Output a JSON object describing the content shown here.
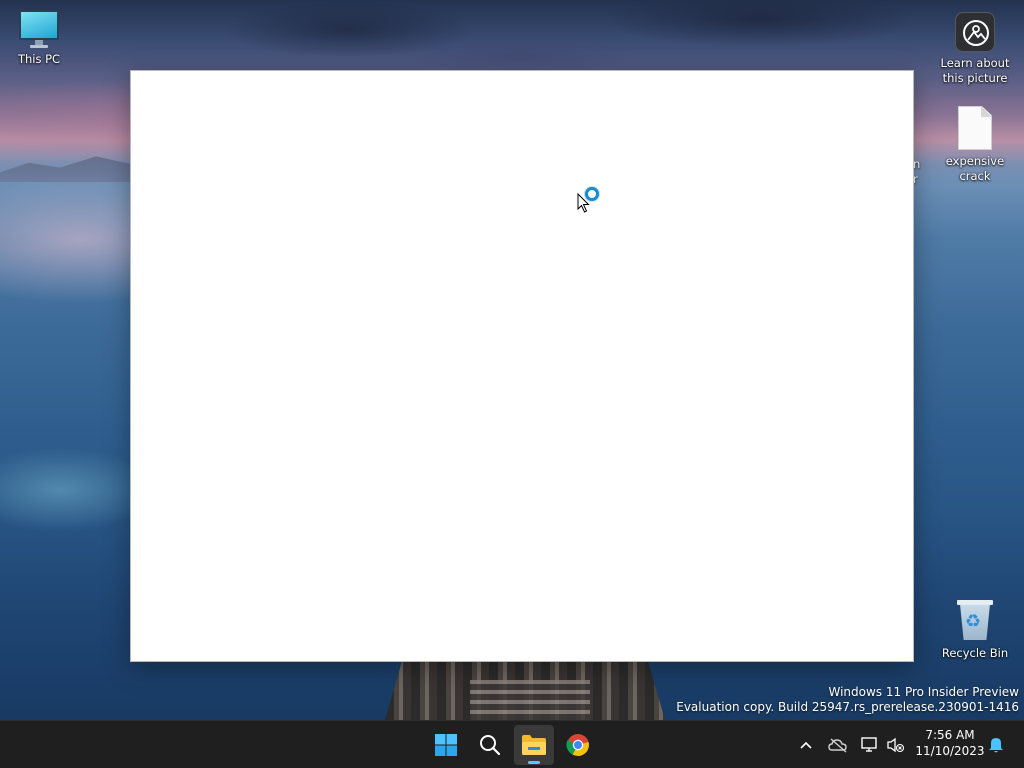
{
  "desktop": {
    "icons": [
      {
        "label": "This PC"
      },
      {
        "label": "Learn about this picture"
      },
      {
        "label": "expensive crack"
      },
      {
        "label": "Recycle Bin"
      }
    ],
    "peek_label": "n\nr"
  },
  "watermark": {
    "line1": "Windows 11 Pro Insider Preview",
    "line2": "Evaluation copy. Build 25947.rs_prerelease.230901-1416"
  },
  "taskbar": {
    "pinned": [
      {
        "icon": "windows-start-icon"
      },
      {
        "icon": "search-icon"
      },
      {
        "icon": "file-explorer-icon",
        "active": true
      },
      {
        "icon": "chrome-icon"
      }
    ],
    "tray": {
      "icons": [
        "chevron-up-icon",
        "onedrive-icon",
        "network-icon",
        "volume-muted-icon",
        "notification-bell-icon"
      ]
    },
    "clock": {
      "time": "7:56 AM",
      "date": "11/10/2023"
    }
  },
  "colors": {
    "accent": "#60c3f5",
    "taskbar": "#1f1f1f",
    "busy_ring": "#1a8ad4"
  }
}
